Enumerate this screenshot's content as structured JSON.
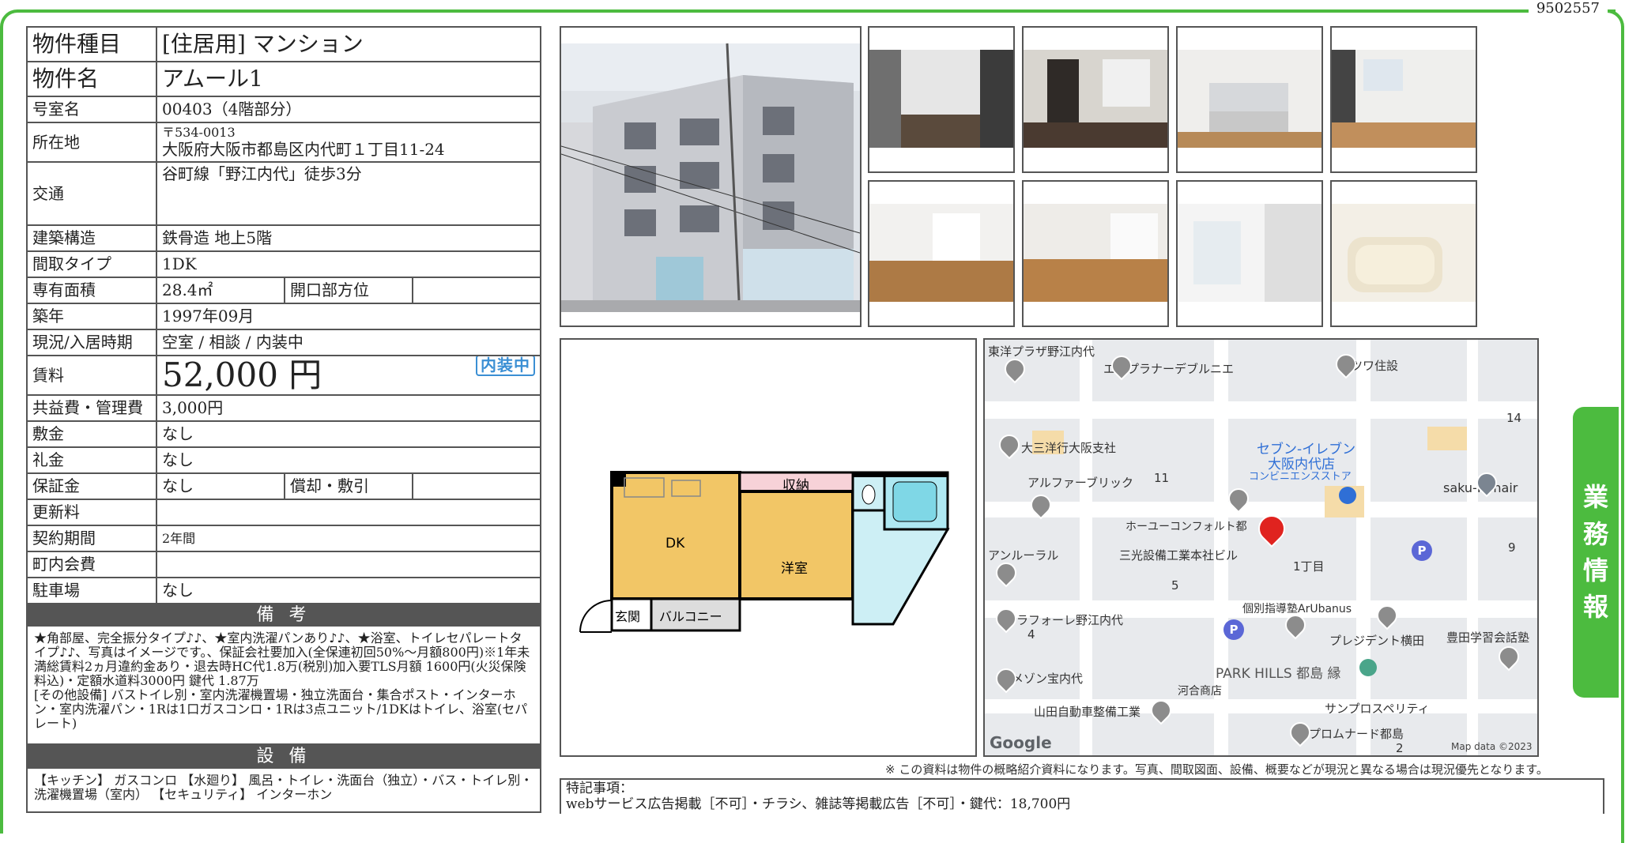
{
  "property_id": "9502557",
  "table": {
    "type_label": "物件種目",
    "type_value": "[住居用] マンション",
    "name_label": "物件名",
    "name_value": "アムール1",
    "room_label": "号室名",
    "room_value": "00403（4階部分）",
    "address_label": "所在地",
    "postal": "〒534-0013",
    "address": "大阪府大阪市都島区内代町１丁目11-24",
    "transport_label": "交通",
    "transport_value": "谷町線「野江内代」徒歩3分",
    "structure_label": "建築構造",
    "structure_value": "鉄骨造 地上5階",
    "layout_label": "間取タイプ",
    "layout_value": "1DK",
    "area_label": "専有面積",
    "area_value": "28.4㎡",
    "opening_label": "開口部方位",
    "opening_value": "",
    "built_label": "築年",
    "built_value": "1997年09月",
    "status_label": "現況/入居時期",
    "status_value": "空室 / 相談 / 内装中",
    "rent_label": "賃料",
    "rent_value": "52,000 円",
    "badge": "内装中",
    "fee_label": "共益費・管理費",
    "fee_value": "3,000円",
    "deposit_label": "敷金",
    "deposit_value": "なし",
    "key_money_label": "礼金",
    "key_money_value": "なし",
    "guarantee_label": "保証金",
    "guarantee_value": "なし",
    "amortize_label": "償却・敷引",
    "amortize_value": "",
    "renewal_label": "更新料",
    "renewal_value": "",
    "contract_label": "契約期間",
    "contract_value": "2年間",
    "association_label": "町内会費",
    "association_value": "",
    "parking_label": "駐車場",
    "parking_value": "なし",
    "remarks_head": "備 考",
    "remarks": "★角部屋、完全振分タイプ♪♪、★室内洗濯パンあり♪♪、★浴室、トイレセパレートタイプ♪♪、写真はイメージです。、保証会社要加入(全保連初回50%～月額800円)※1年未満総賃料2ヵ月違約金あり・退去時HC代1.8万(税別)加入要TLS月額 1600円(火災保険料込)・定額水道料3000円 鍵代 1.87万\n[その他設備] バストイレ別・室内洗濯機置場・独立洗面台・集合ポスト・インターホン・室内洗濯パン・1Rは1口ガスコンロ・1Rは3点ユニット/1DKはトイレ、浴室(セパレート)",
    "equipment_head": "設 備",
    "equipment": "【キッチン】 ガスコンロ 【水廻り】 風呂・トイレ・洗面台（独立）・バス・トイレ別・洗濯機置場（室内） 【セキュリティ】 インターホン"
  },
  "floorplan": {
    "dk": "DK",
    "western": "洋室",
    "storage": "収納",
    "entrance": "玄関",
    "balcony": "バルコニー"
  },
  "map": {
    "labels": [
      "東洋プラザ野江内代",
      "エスプラナーデブルニエ",
      "ミツワ住設",
      "14",
      "大三洋行大阪支社",
      "セブン-イレブン",
      "大阪内代店",
      "コンビニエンスストア",
      "アルファーブリック",
      "11",
      "saku-Rahair",
      "ホーユーコンフォルト都",
      "アンルーラル",
      "三光設備工業本社ビル",
      "1丁目",
      "9",
      "5",
      "個別指導塾ArUbanus",
      "ラフォーレ野江内代",
      "4",
      "プレジデント横田",
      "豊田学習会話塾",
      "PARK HILLS 都島 縁",
      "メゾン宝内代",
      "河合商店",
      "山田自動車整備工業",
      "サンプロスペリティ",
      "プロムナード都島",
      "2"
    ],
    "google": "Google",
    "attribution": "Map data ©2023"
  },
  "disclaimer": "※ この資料は物件の概略紹介資料になります。写真、間取図面、設備、概要などが現況と異なる場合は現況優先となります。",
  "special": {
    "head": "特記事項：",
    "text": "webサービス広告掲載［不可］・チラシ、雑誌等掲載広告［不可］・鍵代：18,700円"
  },
  "side_tab": [
    "業",
    "務",
    "情",
    "報"
  ]
}
